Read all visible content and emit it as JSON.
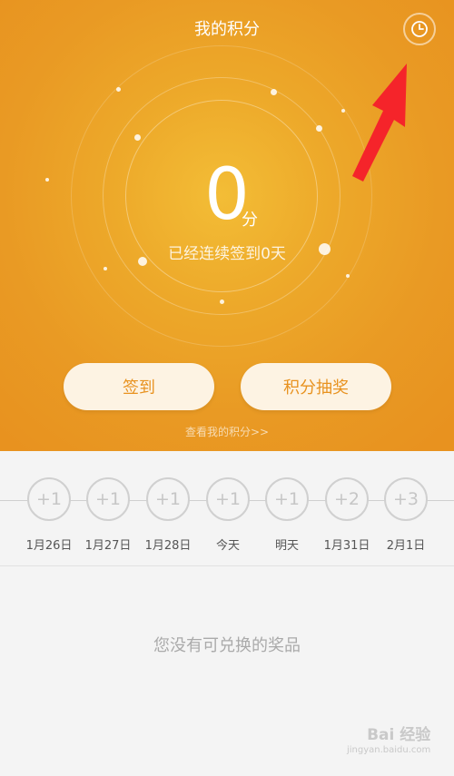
{
  "header": {
    "title": "我的积分",
    "history_icon": "clock-icon"
  },
  "score": {
    "value": "0",
    "unit": "分",
    "streak_text": "已经连续签到0天"
  },
  "actions": {
    "sign_in": "签到",
    "lottery": "积分抽奖",
    "view_points": "查看我的积分>>"
  },
  "timeline": [
    {
      "points": "+1",
      "date": "1月26日"
    },
    {
      "points": "+1",
      "date": "1月27日"
    },
    {
      "points": "+1",
      "date": "1月28日"
    },
    {
      "points": "+1",
      "date": "今天"
    },
    {
      "points": "+1",
      "date": "明天"
    },
    {
      "points": "+2",
      "date": "1月31日"
    },
    {
      "points": "+3",
      "date": "2月1日"
    }
  ],
  "rewards": {
    "empty_text": "您没有可兑换的奖品"
  },
  "watermark": {
    "line1": "Bai 经验",
    "line2": "jingyan.baidu.com"
  },
  "colors": {
    "header_orange": "#e99a24",
    "button_bg": "#fdf3e3",
    "annotation_arrow": "#f5242a"
  }
}
